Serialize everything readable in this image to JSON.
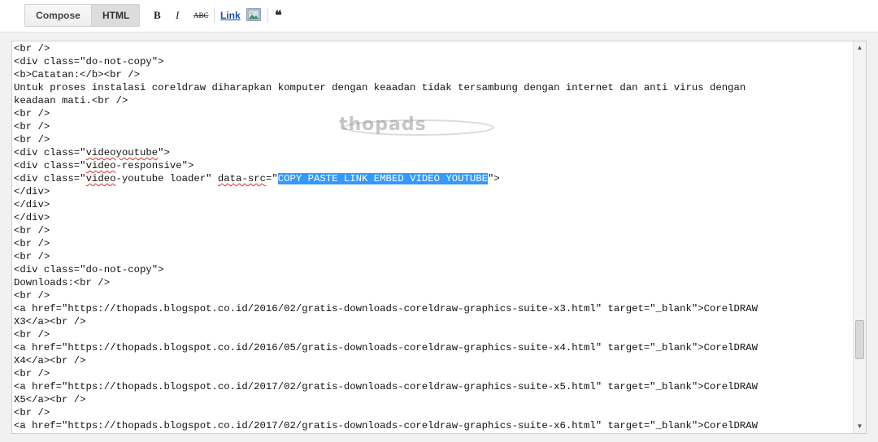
{
  "toolbar": {
    "compose_label": "Compose",
    "html_label": "HTML",
    "bold_label": "B",
    "italic_label": "I",
    "strike_label": "ABC",
    "link_label": "Link",
    "quote_label": "❝"
  },
  "watermark": {
    "text": "thopads"
  },
  "code": {
    "lines": [
      "<br />",
      "<div class=\"do-not-copy\">",
      "<b>Catatan:</b><br />",
      "Untuk proses instalasi coreldraw diharapkan komputer dengan keaadan tidak tersambung dengan internet dan anti virus dengan",
      "keadaan mati.<br />",
      "<br />",
      "<br />",
      "<br />",
      "<div class=\"videoyoutube\">",
      "<div class=\"video-responsive\">",
      "<div class=\"video-youtube loader\" data-src=\"COPY PASTE LINK EMBED VIDEO YOUTUBE\">",
      "</div>",
      "</div>",
      "</div>",
      "<br />",
      "<br />",
      "<br />",
      "<div class=\"do-not-copy\">",
      "Downloads:<br />",
      "<br />",
      "<a href=\"https://thopads.blogspot.co.id/2016/02/gratis-downloads-coreldraw-graphics-suite-x3.html\" target=\"_blank\">CorelDRAW",
      "X3</a><br />",
      "<br />",
      "<a href=\"https://thopads.blogspot.co.id/2016/05/gratis-downloads-coreldraw-graphics-suite-x4.html\" target=\"_blank\">CorelDRAW",
      "X4</a><br />",
      "<br />",
      "<a href=\"https://thopads.blogspot.co.id/2017/02/gratis-downloads-coreldraw-graphics-suite-x5.html\" target=\"_blank\">CorelDRAW",
      "X5</a><br />",
      "<br />",
      "<a href=\"https://thopads.blogspot.co.id/2017/02/gratis-downloads-coreldraw-graphics-suite-x6.html\" target=\"_blank\">CorelDRAW"
    ],
    "selected_text": "COPY PASTE LINK EMBED VIDEO YOUTUBE",
    "misspelled_words": [
      "videoyoutube",
      "video",
      "data-src"
    ]
  },
  "colors": {
    "selection": "#3399ff",
    "link": "#1a4ea8",
    "spellcheck": "#e0302a"
  },
  "icons": {
    "image": "image-icon",
    "quote": "quote-icon",
    "scroll_up": "scroll-up-icon",
    "scroll_down": "scroll-down-icon"
  }
}
